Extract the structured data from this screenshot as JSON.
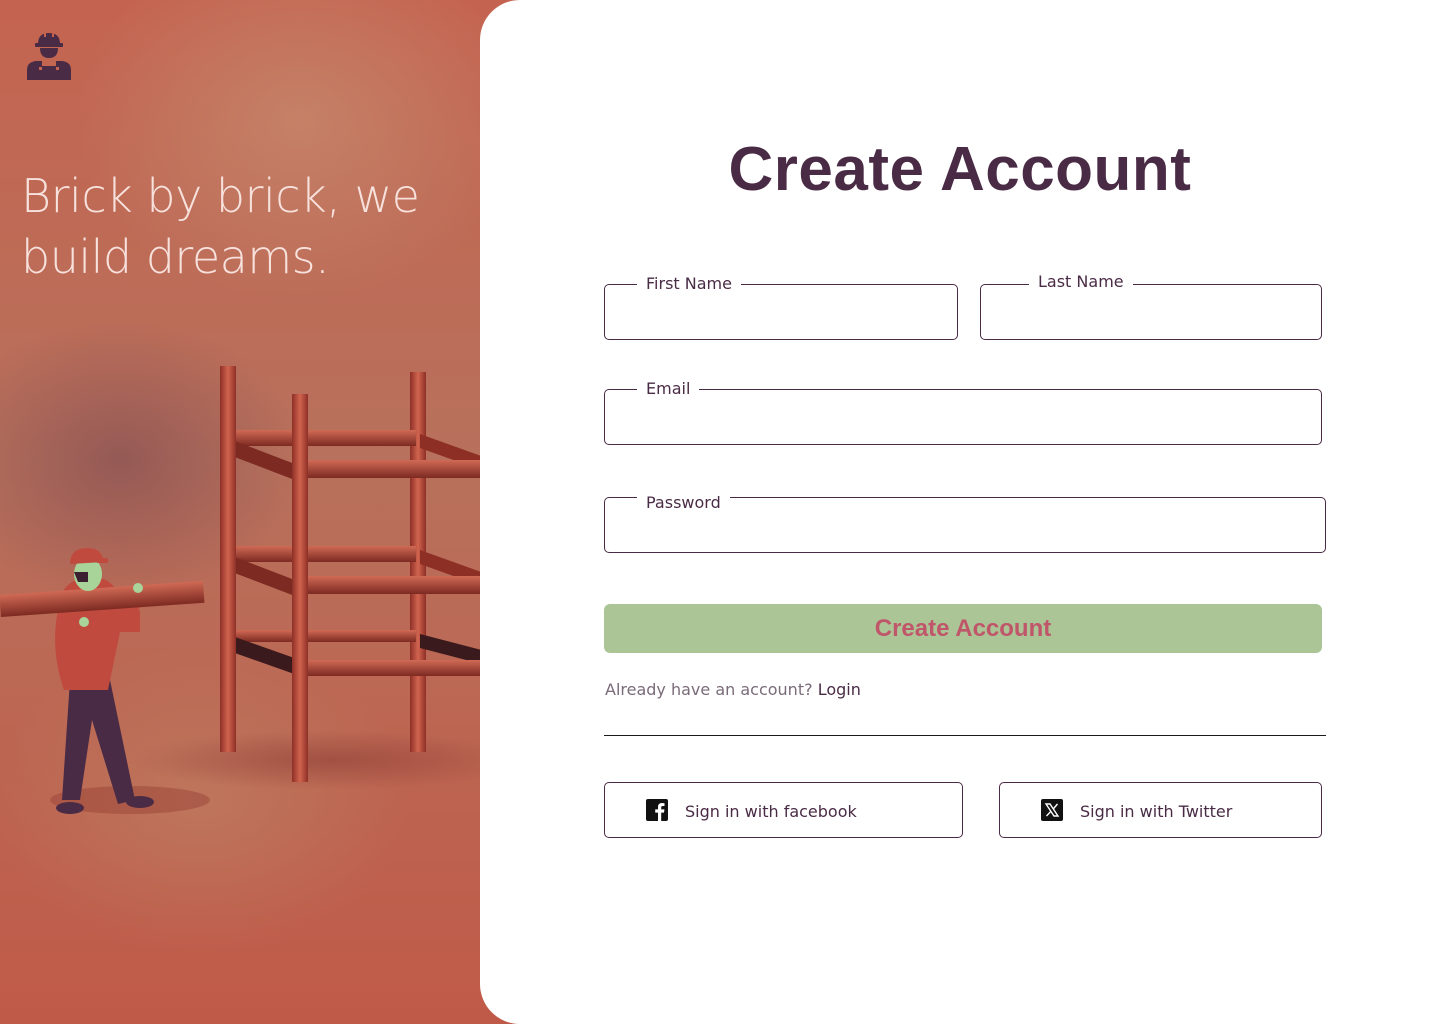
{
  "hero": {
    "tagline": "Brick by brick, we build dreams.",
    "logo_icon": "construction-worker-icon",
    "illustration": "worker-carrying-beam-scaffolding"
  },
  "form": {
    "title": "Create Account",
    "first_name_label": "First Name",
    "last_name_label": "Last Name",
    "email_label": "Email",
    "password_label": "Password",
    "submit_label": "Create Account",
    "login_prompt": "Already have an account?",
    "login_link": "Login"
  },
  "social": {
    "facebook_label": "Sign in with facebook",
    "facebook_icon": "facebook-icon",
    "twitter_label": "Sign in with Twitter",
    "twitter_icon": "x-twitter-icon"
  },
  "colors": {
    "hero_background": "#c0594a",
    "title_text": "#4a2b45",
    "primary_button": "#acc596",
    "primary_button_text": "#c0566a"
  }
}
